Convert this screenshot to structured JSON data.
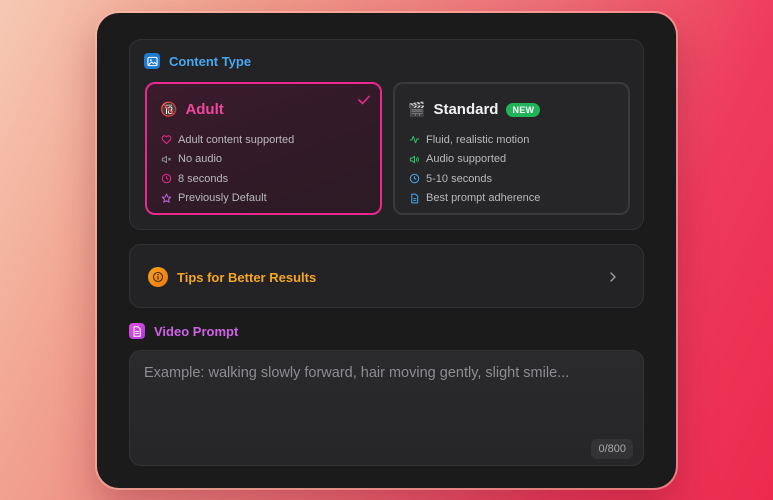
{
  "content_type": {
    "title": "Content Type",
    "icon": "image-icon",
    "options": [
      {
        "id": "adult",
        "label": "Adult",
        "emoji": "🔞",
        "selected": true,
        "features": [
          {
            "icon": "heart-icon",
            "text": "Adult content supported"
          },
          {
            "icon": "speaker-muted-icon",
            "text": "No audio"
          },
          {
            "icon": "clock-icon",
            "text": "8 seconds"
          },
          {
            "icon": "star-icon",
            "text": "Previously Default"
          }
        ]
      },
      {
        "id": "standard",
        "label": "Standard",
        "emoji": "🎬",
        "badge": "NEW",
        "selected": false,
        "features": [
          {
            "icon": "activity-icon",
            "text": "Fluid, realistic motion"
          },
          {
            "icon": "speaker-icon",
            "text": "Audio supported"
          },
          {
            "icon": "clock-icon",
            "text": "5-10 seconds"
          },
          {
            "icon": "document-icon",
            "text": "Best prompt adherence"
          }
        ]
      }
    ]
  },
  "tips": {
    "label": "Tips for Better Results",
    "icon": "info-icon"
  },
  "video_prompt": {
    "title": "Video Prompt",
    "icon": "document-icon",
    "value": "",
    "placeholder": "Example: walking slowly forward, hair moving gently, slight smile...",
    "counter": "0/800"
  },
  "colors": {
    "adult_accent": "#e8298e",
    "standard_feature_green": "#2fc26b",
    "standard_feature_blue": "#4aa6ee",
    "tips_accent": "#f5a623",
    "prompt_accent": "#cf62e6"
  }
}
